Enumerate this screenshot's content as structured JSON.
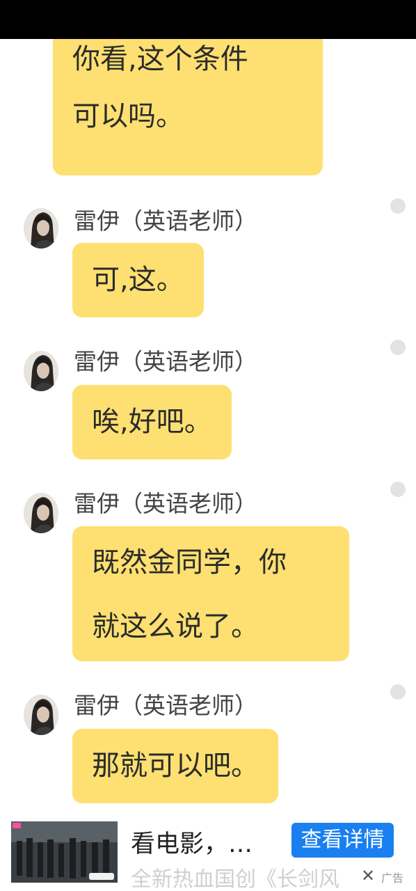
{
  "status_bar": {
    "background": "#000000"
  },
  "colors": {
    "bubble": "#fde071",
    "cta": "#1a7ff0"
  },
  "messages": [
    {
      "lines": [
        "你看,这个条件",
        "可以吗。"
      ]
    },
    {
      "sender": "雷伊（英语老师）",
      "text": "可,这。"
    },
    {
      "sender": "雷伊（英语老师）",
      "text": "唉,好吧。"
    },
    {
      "sender": "雷伊（英语老师）",
      "lines": [
        "既然金同学，你",
        "就这么说了。"
      ]
    },
    {
      "sender": "雷伊（英语老师）",
      "text": "那就可以吧。"
    }
  ],
  "ad": {
    "headline": "看电影，…",
    "cta_label": "查看详情",
    "subtitle": "全新热血国创《长剑风",
    "close_glyph": "✕",
    "ad_label": "广告",
    "thumb_icon": "movie-still-icon"
  }
}
